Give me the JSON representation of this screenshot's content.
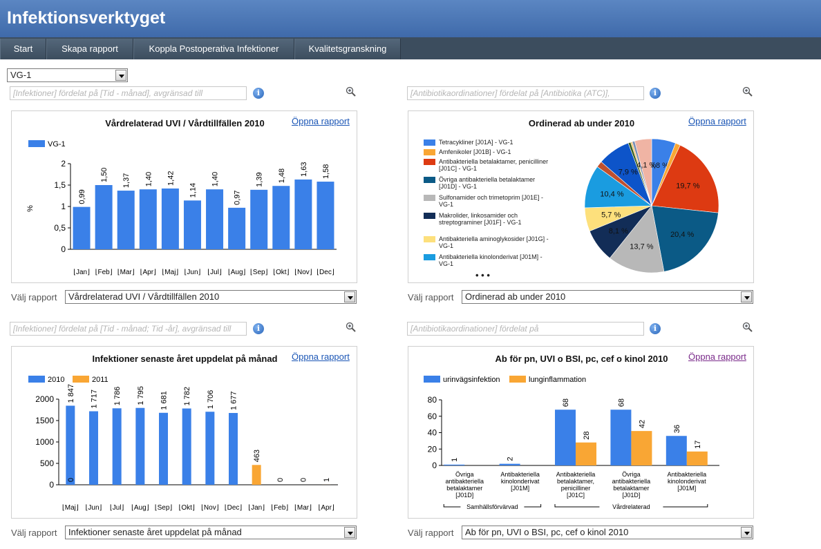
{
  "app": {
    "title": "Infektionsverktyget"
  },
  "nav": {
    "tabs": [
      "Start",
      "Skapa rapport",
      "Koppla Postoperativa Infektioner",
      "Kvalitetsgranskning"
    ]
  },
  "unit_select": {
    "value": "VG-1"
  },
  "colors": {
    "blue": "#3a80e8",
    "orange": "#f9a634",
    "header": "#4a75b5",
    "nav": "#3c4d5e"
  },
  "panels": [
    {
      "filter": "[Infektioner] fördelat på [Tid - månad], avgränsad till",
      "title": "Vårdrelaterad UVI / Vårdtillfällen 2010",
      "open_label": "Öppna rapport",
      "select_label": "Välj rapport",
      "select_value": "Vårdrelaterad UVI / Vårdtillfällen 2010"
    },
    {
      "filter": "[Antibiotikaordinationer] fördelat på [Antibiotika (ATC)],",
      "title": "Ordinerad ab under 2010",
      "open_label": "Öppna rapport",
      "select_label": "Välj rapport",
      "select_value": "Ordinerad ab under 2010"
    },
    {
      "filter": "[Infektioner] fördelat på [Tid - månad; Tid -år], avgränsad till",
      "title": "Infektioner senaste året uppdelat på månad",
      "open_label": "Öppna rapport",
      "select_label": "Välj rapport",
      "select_value": "Infektioner senaste året uppdelat på månad"
    },
    {
      "filter": "[Antibiotikaordinationer] fördelat på",
      "title": "Ab för pn, UVI o BSI, pc, cef o kinol 2010",
      "open_label": "Öppna rapport",
      "select_label": "Välj rapport",
      "select_value": "Ab för pn, UVI o BSI, pc, cef o kinol 2010"
    }
  ],
  "chart_data": [
    {
      "type": "bar",
      "title": "Vårdrelaterad UVI / Vårdtillfällen 2010",
      "ylabel": "%",
      "ylim": [
        0,
        2
      ],
      "yticks": [
        "0",
        "0,5",
        "1",
        "1,5",
        "2"
      ],
      "categories": [
        "Jan",
        "Feb",
        "Mar",
        "Apr",
        "Maj",
        "Jun",
        "Jul",
        "Aug",
        "Sep",
        "Okt",
        "Nov",
        "Dec"
      ],
      "series": [
        {
          "name": "VG-1",
          "values": [
            0.99,
            1.5,
            1.37,
            1.4,
            1.42,
            1.14,
            1.4,
            0.97,
            1.39,
            1.48,
            1.63,
            1.58
          ],
          "labels": [
            "0,99",
            "1,50",
            "1,37",
            "1,40",
            "1,42",
            "1,14",
            "1,40",
            "0,97",
            "1,39",
            "1,48",
            "1,63",
            "1,58"
          ]
        }
      ],
      "legend": "top-left",
      "grid": false
    },
    {
      "type": "pie",
      "title": "Ordinerad ab under 2010",
      "legend": "left",
      "legend_entries": [
        {
          "label": "Tetracykliner [J01A] - VG-1",
          "color": "#3a80e8"
        },
        {
          "label": "Amfenikoler [J01B] - VG-1",
          "color": "#f9a634"
        },
        {
          "label": "Antibakteriella betalaktamer, penicilliner [J01C] - VG-1",
          "color": "#dd3a12"
        },
        {
          "label": "Övriga antibakteriella betalaktamer [J01D] - VG-1",
          "color": "#0b5a86"
        },
        {
          "label": "Sulfonamider och trimetoprim [J01E] - VG-1",
          "color": "#b8b8b8"
        },
        {
          "label": "Makrolider, linkosamider och streptograminer [J01F] - VG-1",
          "color": "#122d57"
        },
        {
          "label": "Antibakteriella aminoglykosider [J01G] - VG-1",
          "color": "#fde07c"
        },
        {
          "label": "Antibakteriella kinolonderivat [J01M] - VG-1",
          "color": "#1a9ce0"
        }
      ],
      "legend_more": "• • •",
      "slices": [
        {
          "value": 5.8,
          "label": "5,8 %",
          "color": "#3a80e8"
        },
        {
          "value": 1.2,
          "label": "",
          "color": "#f9a634"
        },
        {
          "value": 19.7,
          "label": "19,7 %",
          "color": "#dd3a12"
        },
        {
          "value": 20.4,
          "label": "20,4 %",
          "color": "#0b5a86"
        },
        {
          "value": 13.7,
          "label": "13,7 %",
          "color": "#b8b8b8"
        },
        {
          "value": 8.1,
          "label": "8,1 %",
          "color": "#122d57"
        },
        {
          "value": 5.7,
          "label": "5,7 %",
          "color": "#fde07c"
        },
        {
          "value": 10.4,
          "label": "10,4 %",
          "color": "#1a9ce0"
        },
        {
          "value": 1.5,
          "label": "",
          "color": "#c0502e"
        },
        {
          "value": 7.9,
          "label": "7,9 %",
          "color": "#0d54c9"
        },
        {
          "value": 0.6,
          "label": "",
          "color": "#3a6020"
        },
        {
          "value": 0.4,
          "label": "",
          "color": "#f6c46a"
        },
        {
          "value": 0.6,
          "label": "",
          "color": "#7a8fb5"
        },
        {
          "value": 4.1,
          "label": "4,1 %",
          "color": "#f0b4a4"
        }
      ]
    },
    {
      "type": "bar",
      "title": "Infektioner senaste året uppdelat på månad",
      "ylim": [
        0,
        2000
      ],
      "yticks": [
        "0",
        "500",
        "1000",
        "1500",
        "2000"
      ],
      "categories": [
        "Maj",
        "Jun",
        "Jul",
        "Aug",
        "Sep",
        "Okt",
        "Nov",
        "Dec",
        "Jan",
        "Feb",
        "Mar",
        "Apr"
      ],
      "series": [
        {
          "name": "2010",
          "values": [
            1847,
            1717,
            1786,
            1795,
            1681,
            1782,
            1706,
            1677,
            0,
            0,
            0,
            0
          ],
          "labels": [
            "1 847",
            "1 717",
            "1 786",
            "1 795",
            "1 681",
            "1 782",
            "1 706",
            "1 677",
            "",
            "",
            "",
            ""
          ]
        },
        {
          "name": "2011",
          "values": [
            0,
            0,
            0,
            0,
            0,
            0,
            0,
            0,
            463,
            0,
            0,
            1
          ],
          "labels": [
            "0",
            "",
            "",
            "",
            "",
            "",
            "",
            "",
            "463",
            "0",
            "0",
            "1"
          ]
        }
      ],
      "legend": "top-left",
      "grid": false
    },
    {
      "type": "bar",
      "title": "Ab för pn, UVI o BSI, pc, cef o kinol 2010",
      "ylim": [
        0,
        80
      ],
      "yticks": [
        "0",
        "20",
        "40",
        "60",
        "80"
      ],
      "categories": [
        "Övriga antibakteriella betalaktamer [J01D]",
        "Antibakteriella kinolonderivat [J01M]",
        "Antibakteriella betalaktamer, penicilliner [J01C]",
        "Övriga antibakteriella betalaktamer [J01D]",
        "Antibakteriella kinolonderivat [J01M]"
      ],
      "category_lines": [
        [
          "Övriga",
          "antibakteriella",
          "betalaktamer",
          "[J01D]"
        ],
        [
          "Antibakteriella",
          "kinolonderivat",
          "[J01M]"
        ],
        [
          "Antibakteriella",
          "betalaktamer,",
          "penicilliner",
          "[J01C]"
        ],
        [
          "Övriga",
          "antibakteriella",
          "betalaktamer",
          "[J01D]"
        ],
        [
          "Antibakteriella",
          "kinolonderivat",
          "[J01M]"
        ]
      ],
      "groups": [
        {
          "label": "Samhällsförvärvad",
          "from": 0,
          "to": 1
        },
        {
          "label": "Vårdrelaterad",
          "from": 2,
          "to": 4
        }
      ],
      "series": [
        {
          "name": "urinvägsinfektion",
          "values": [
            1,
            2,
            68,
            68,
            36
          ],
          "labels": [
            "1",
            "2",
            "68",
            "68",
            "36"
          ]
        },
        {
          "name": "lunginflammation",
          "values": [
            0,
            0,
            28,
            42,
            17
          ],
          "labels": [
            "",
            "",
            "28",
            "42",
            "17"
          ]
        }
      ],
      "legend": "top-left",
      "grid": false
    }
  ]
}
